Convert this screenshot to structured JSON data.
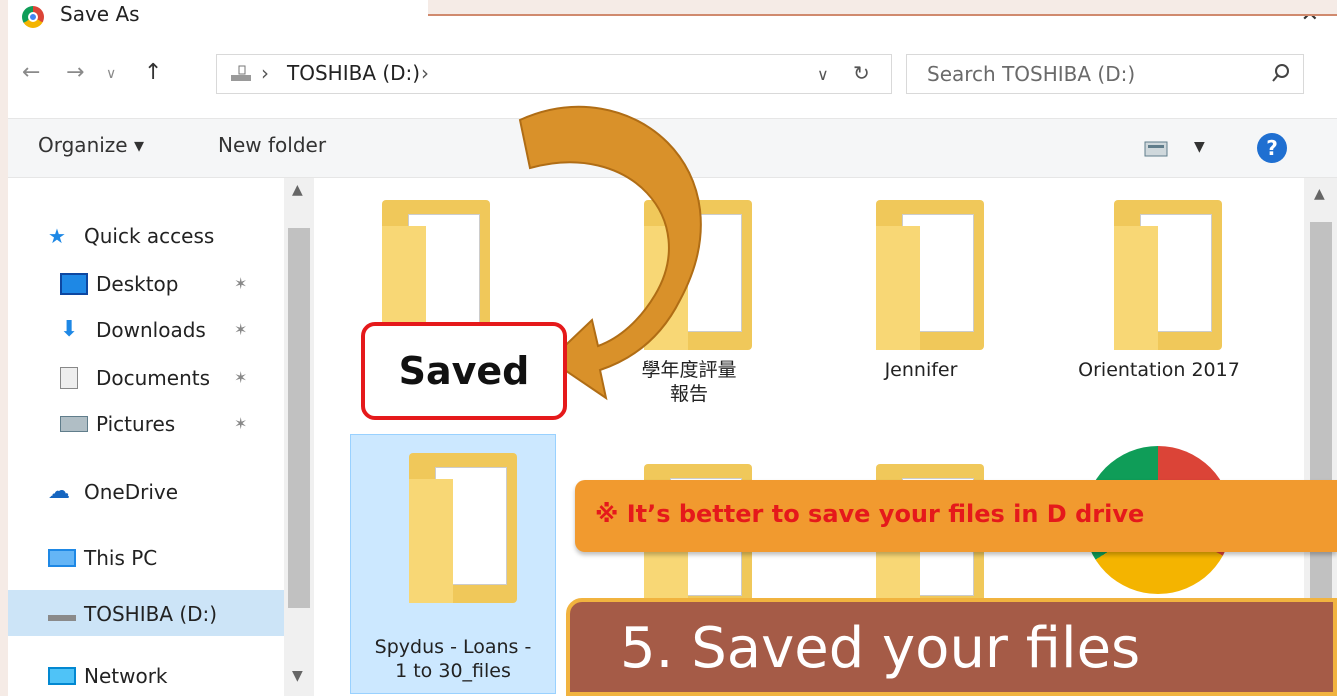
{
  "window": {
    "title": "Save As"
  },
  "address": {
    "path": "TOSHIBA (D:)"
  },
  "search": {
    "placeholder": "Search TOSHIBA (D:)"
  },
  "toolbar": {
    "organize": "Organize ▾",
    "new_folder": "New folder"
  },
  "sidebar": {
    "items": [
      {
        "label": "Quick access",
        "icon": "star-icon"
      },
      {
        "label": "Desktop",
        "icon": "desktop-icon",
        "pinned": true
      },
      {
        "label": "Downloads",
        "icon": "download-arrow-icon",
        "pinned": true
      },
      {
        "label": "Documents",
        "icon": "documents-icon",
        "pinned": true
      },
      {
        "label": "Pictures",
        "icon": "pictures-icon",
        "pinned": true
      },
      {
        "label": "OneDrive",
        "icon": "cloud-icon"
      },
      {
        "label": "This PC",
        "icon": "monitor-icon"
      },
      {
        "label": "TOSHIBA (D:)",
        "icon": "drive-icon",
        "selected": true
      },
      {
        "label": "Network",
        "icon": "network-icon"
      }
    ]
  },
  "files": [
    {
      "label": ""
    },
    {
      "label": "學年度評量\n報告"
    },
    {
      "label": "Jennifer"
    },
    {
      "label": "Orientation 2017"
    },
    {
      "label": "Spydus - Loans -\n1 to 30_files",
      "selected": true
    }
  ],
  "annotations": {
    "saved": "Saved",
    "banner": "※ It’s better to save your files in D drive",
    "step": "5. Saved your files"
  },
  "colors": {
    "accent_red": "#e5191b",
    "banner_orange": "#f19a2f",
    "step_brown": "#a55b47",
    "selection_blue": "#cce8ff"
  }
}
